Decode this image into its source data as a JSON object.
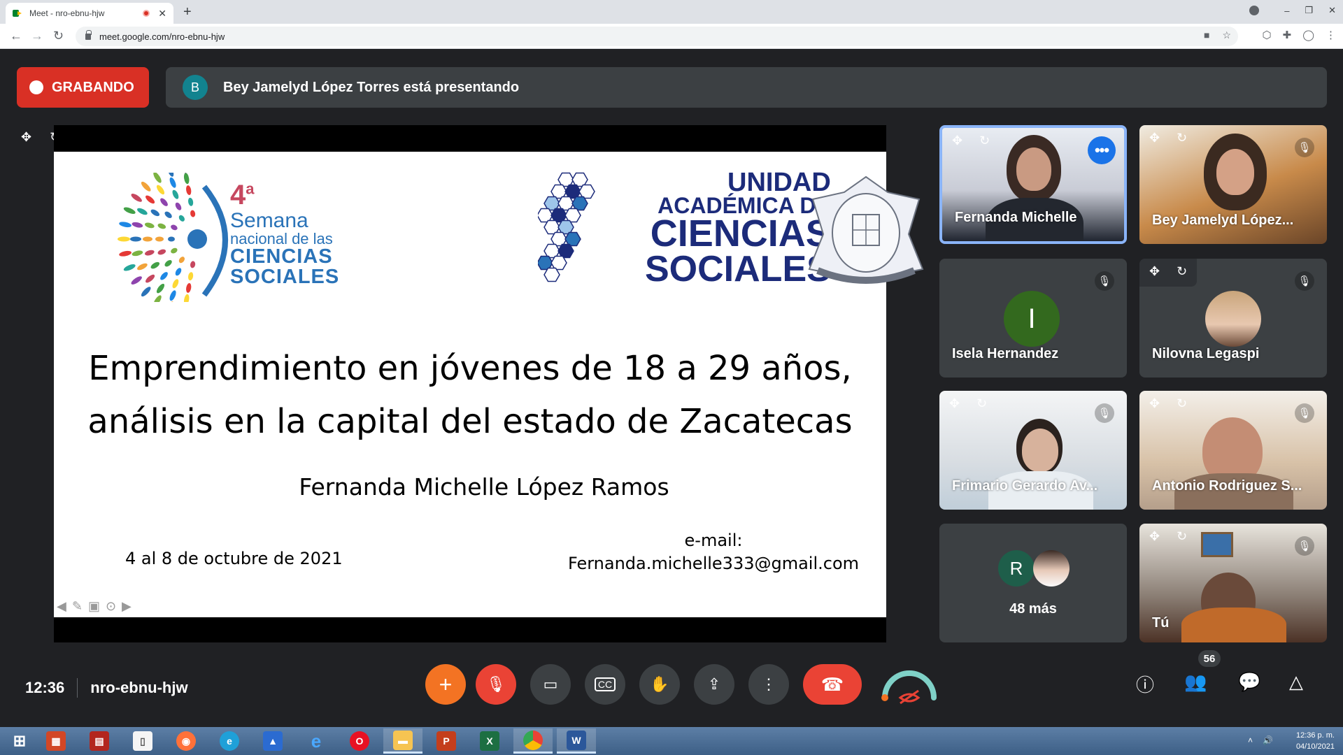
{
  "browser": {
    "tab_title": "Meet - nro-ebnu-hjw",
    "tab_close": "✕",
    "new_tab": "+",
    "url": "meet.google.com/nro-ebnu-hjw",
    "window_controls": [
      "–",
      "❐",
      "✕"
    ]
  },
  "meet": {
    "recording_label": "GRABANDO",
    "presenter_initial": "B",
    "presenting_text": "Bey Jamelyd López Torres está presentando",
    "meeting_code": "nro-ebnu-hjw",
    "time": "12:36",
    "participant_count": "56"
  },
  "slide": {
    "logo_number": "4",
    "logo_superscript": "a",
    "logo_line1": "Semana",
    "logo_line2": "nacional de las",
    "logo_line3": "CIENCIAS",
    "logo_line4": "SOCIALES",
    "uacs_line1": "UNIDAD",
    "uacs_line2": "ACADÉMICA DE",
    "uacs_line3": "CIENCIAS",
    "uacs_line4": "SOCIALES",
    "title_line1": "Emprendimiento en jóvenes de 18 a 29 años,",
    "title_line2": "análisis en la capital del estado de Zacatecas",
    "author": "Fernanda Michelle López Ramos",
    "date": "4 al 8 de octubre de 2021",
    "email_label": "e-mail:",
    "email": "Fernanda.michelle333@gmail.com"
  },
  "participants": [
    {
      "name": "Fernanda Michelle"
    },
    {
      "name": "Bey Jamelyd López..."
    },
    {
      "name": "Isela Hernandez",
      "initial": "I",
      "color": "#33691e"
    },
    {
      "name": "Nilovna Legaspi"
    },
    {
      "name": "Frimario Gerardo Av..."
    },
    {
      "name": "Antonio Rodriguez S..."
    },
    {
      "name": "48 más",
      "initial": "R",
      "color": "#1e5e4a"
    },
    {
      "name": "Tú"
    }
  ],
  "taskbar": {
    "time": "12:36 p. m.",
    "date": "04/10/2021"
  },
  "colors": {
    "recording": "#d93025",
    "hangup": "#ea4335",
    "add": "#f37323",
    "active_border": "#8ab4f8"
  }
}
